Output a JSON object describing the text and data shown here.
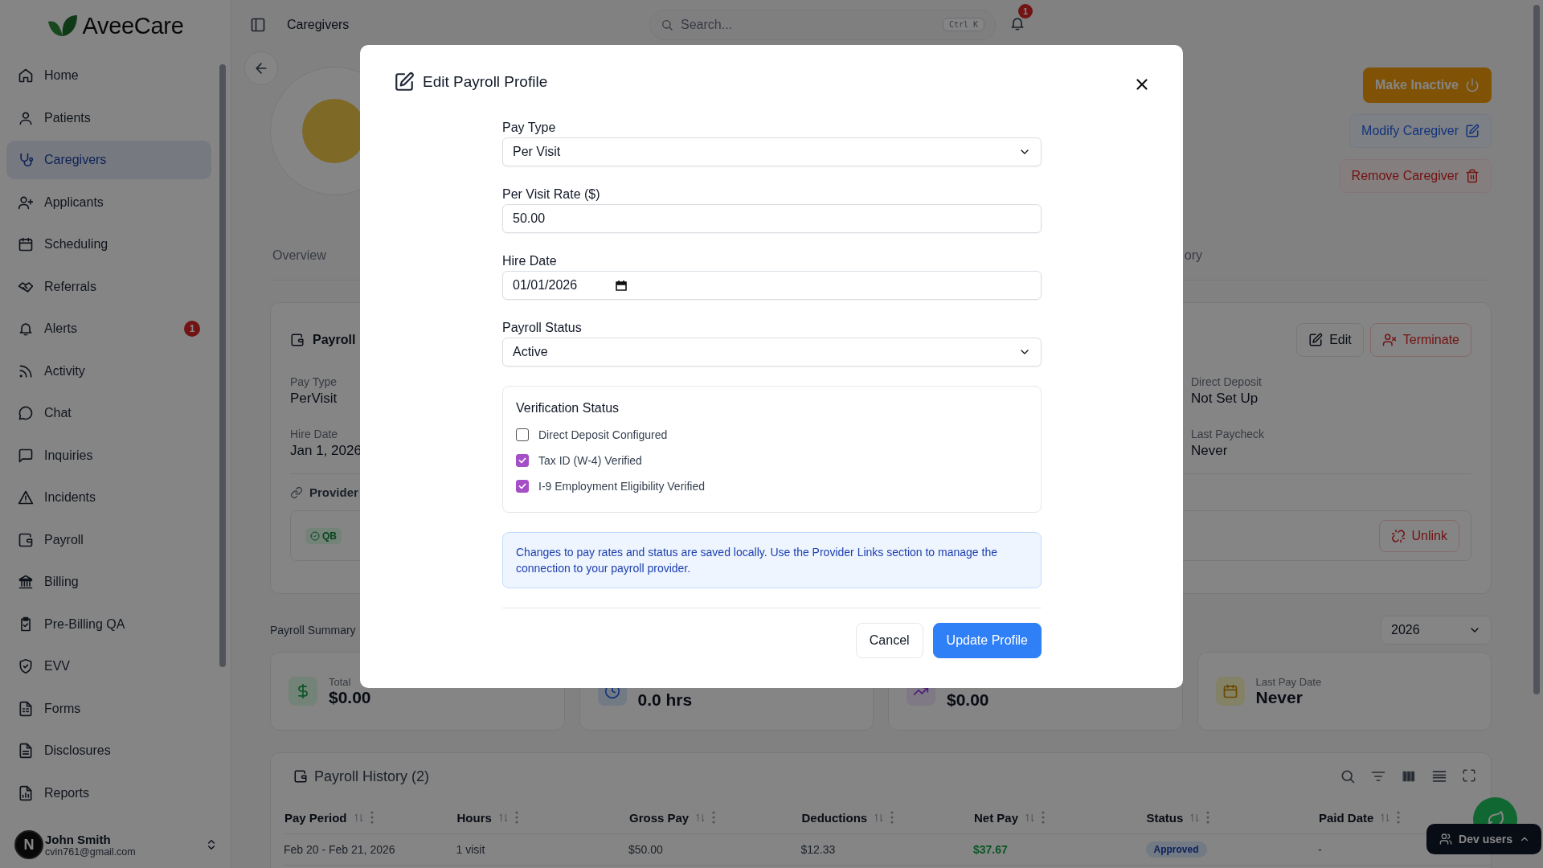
{
  "sidebar": {
    "logo": "AveeCare",
    "items": [
      {
        "label": "Home",
        "selected": false
      },
      {
        "label": "Patients",
        "selected": false
      },
      {
        "label": "Caregivers",
        "selected": true
      },
      {
        "label": "Applicants",
        "selected": false
      },
      {
        "label": "Scheduling",
        "selected": false
      },
      {
        "label": "Referrals",
        "selected": false
      },
      {
        "label": "Alerts",
        "selected": false,
        "badge": "1"
      },
      {
        "label": "Activity",
        "selected": false
      },
      {
        "label": "Chat",
        "selected": false
      },
      {
        "label": "Inquiries",
        "selected": false
      },
      {
        "label": "Incidents",
        "selected": false
      },
      {
        "label": "Payroll",
        "selected": false
      },
      {
        "label": "Billing",
        "selected": false
      },
      {
        "label": "Pre-Billing QA",
        "selected": false
      },
      {
        "label": "EVV",
        "selected": false
      },
      {
        "label": "Forms",
        "selected": false
      },
      {
        "label": "Disclosures",
        "selected": false
      },
      {
        "label": "Reports",
        "selected": false
      }
    ],
    "user": {
      "initial": "N",
      "name": "John Smith",
      "email": "cvin761@gmail.com"
    }
  },
  "topbar": {
    "title": "Caregivers",
    "search": {
      "placeholder": "Search...",
      "shortcut": "Ctrl K"
    },
    "notification_count": "1"
  },
  "profile_actions": [
    {
      "label": "Make Inactive",
      "kind": "warning"
    },
    {
      "label": "Modify Caregiver",
      "kind": "primary"
    },
    {
      "label": "Remove Caregiver",
      "kind": "danger"
    }
  ],
  "tabs": [
    {
      "label": "Overview",
      "selected": false
    },
    {
      "label": "ory",
      "selected": false
    }
  ],
  "payroll_profile": {
    "title": "Payroll",
    "actions": [
      {
        "label": "Edit",
        "kind": "default"
      },
      {
        "label": "Terminate",
        "kind": "danger"
      }
    ],
    "fields_left": [
      {
        "label": "Pay Type",
        "value": "PerVisit"
      },
      {
        "label": "Hire Date",
        "value": "Jan 1, 2026"
      }
    ],
    "fields_right": [
      {
        "label": "Direct Deposit",
        "value": "Not Set Up"
      },
      {
        "label": "Last Paycheck",
        "value": "Never"
      }
    ],
    "provider_links": {
      "title": "Provider",
      "badge": "QB",
      "action": "Unlink"
    }
  },
  "payroll_summary": {
    "title": "Payroll Summary",
    "year": "2026",
    "cards": [
      {
        "kind": "money",
        "label": "Total",
        "value": "$0.00"
      },
      {
        "kind": "hours",
        "value": "0.0 hrs"
      },
      {
        "kind": "trend",
        "value": "$0.00"
      },
      {
        "kind": "calendar",
        "label": "Last Pay Date",
        "value": "Never"
      }
    ]
  },
  "payroll_history": {
    "title": "Payroll History (2)",
    "columns": [
      {
        "label": "Pay Period",
        "kind": "text"
      },
      {
        "label": "Hours",
        "kind": "text"
      },
      {
        "label": "Gross Pay",
        "kind": "text"
      },
      {
        "label": "Deductions",
        "kind": "text"
      },
      {
        "label": "Net Pay",
        "kind": "positive"
      },
      {
        "label": "Status",
        "kind": "status"
      },
      {
        "label": "Paid Date",
        "kind": "text"
      }
    ],
    "rows": [
      [
        "Feb 20 - Feb 21, 2026",
        "1 visit",
        "$50.00",
        "$12.33",
        "$37.67",
        "Approved",
        "-"
      ]
    ]
  },
  "dev_users": "Dev users",
  "modal": {
    "title": "Edit Payroll Profile",
    "fields": [
      {
        "kind": "select",
        "label": "Pay Type",
        "value": "Per Visit"
      },
      {
        "kind": "text",
        "label": "Per Visit Rate ($)",
        "value": "50.00"
      },
      {
        "kind": "date",
        "label": "Hire Date",
        "value": "01/01/2026"
      },
      {
        "kind": "select",
        "label": "Payroll Status",
        "value": "Active"
      }
    ],
    "verification": {
      "title": "Verification Status",
      "items": [
        {
          "label": "Direct Deposit Configured",
          "checked": false
        },
        {
          "label": "Tax ID (W-4) Verified",
          "checked": true
        },
        {
          "label": "I-9 Employment Eligibility Verified",
          "checked": true
        }
      ]
    },
    "note": "Changes to pay rates and status are saved locally. Use the Provider Links section to manage the connection to your payroll provider.",
    "buttons": [
      {
        "label": "Cancel",
        "kind": "secondary"
      },
      {
        "label": "Update Profile",
        "kind": "primary"
      }
    ]
  }
}
